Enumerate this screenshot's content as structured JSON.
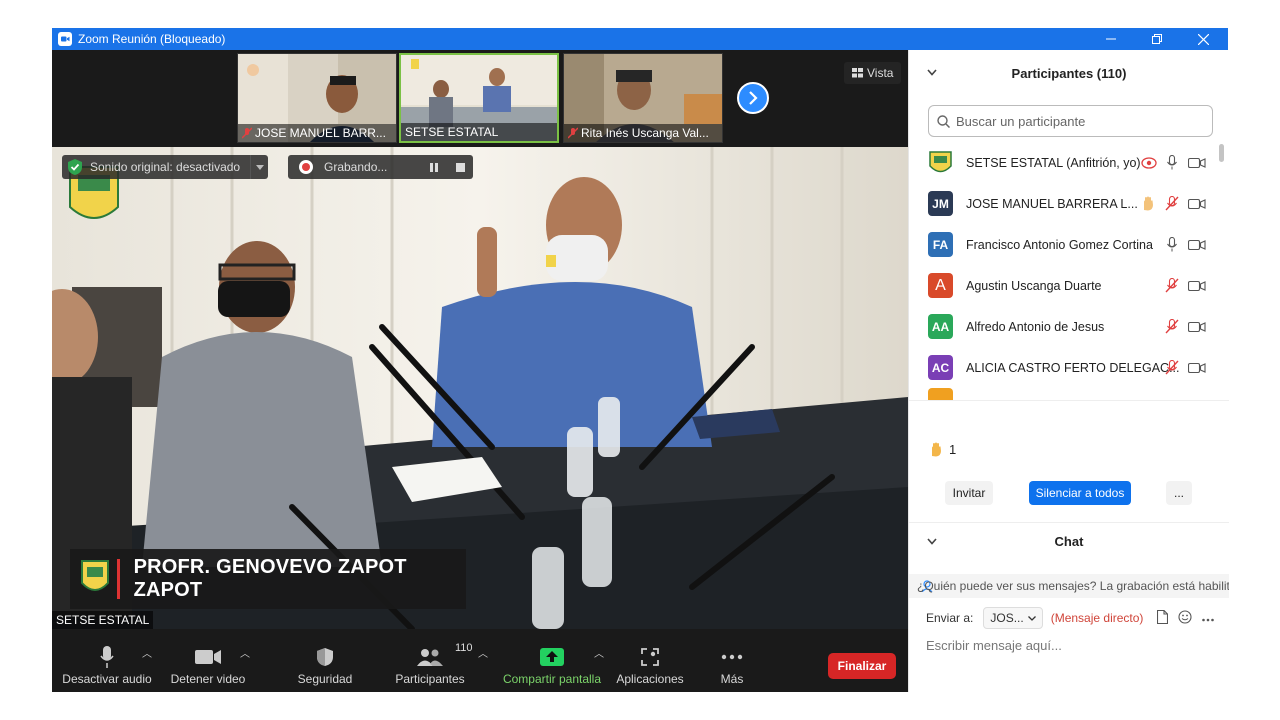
{
  "window": {
    "title": "Zoom Reunión (Bloqueado)"
  },
  "strip": {
    "thumbnails": [
      {
        "label": "JOSE MANUEL BARR..."
      },
      {
        "label": "SETSE ESTATAL"
      },
      {
        "label": "Rita Inés Uscanga Val..."
      }
    ],
    "view_label": "Vista"
  },
  "main_video": {
    "sound_label": "Sonido original: desactivado",
    "recording_label": "Grabando...",
    "speaker_name": "PROFR. GENOVEVO ZAPOT ZAPOT",
    "video_label": "SETSE ESTATAL"
  },
  "toolbar": {
    "mute_label": "Desactivar audio",
    "video_label": "Detener video",
    "security_label": "Seguridad",
    "participants_label": "Participantes",
    "participants_count": "110",
    "share_label": "Compartir pantalla",
    "apps_label": "Aplicaciones",
    "more_label": "Más",
    "end_label": "Finalizar"
  },
  "panel": {
    "title": "Participantes (110)",
    "search_placeholder": "Buscar un participante",
    "participants": [
      {
        "initials": "",
        "name": "SETSE ESTATAL (Anfitrión, yo)",
        "color": "#ffffff",
        "mic": "on",
        "cam": "off",
        "rec": true,
        "hand": false
      },
      {
        "initials": "JM",
        "name": "JOSE MANUEL BARRERA L...",
        "color": "#2b3a55",
        "mic": "muted",
        "cam": "off",
        "rec": false,
        "hand": true
      },
      {
        "initials": "FA",
        "name": "Francisco Antonio Gomez Cortina",
        "color": "#2e6fb5",
        "mic": "on",
        "cam": "off",
        "rec": false,
        "hand": false
      },
      {
        "initials": "A",
        "name": "Agustin Uscanga Duarte",
        "color": "#d94a2a",
        "mic": "muted",
        "cam": "off",
        "rec": false,
        "hand": false
      },
      {
        "initials": "AA",
        "name": "Alfredo Antonio de Jesus",
        "color": "#2aa85a",
        "mic": "muted",
        "cam": "off",
        "rec": false,
        "hand": false
      },
      {
        "initials": "AC",
        "name": "ALICIA CASTRO FERTO DELEGAC...",
        "color": "#7a3fb5",
        "mic": "muted",
        "cam": "off",
        "rec": false,
        "hand": false
      }
    ],
    "raised_hands": "1",
    "invite_label": "Invitar",
    "mute_all_label": "Silenciar a todos",
    "more_label": "...",
    "chat_title": "Chat",
    "chat_note": "¿Quién puede ver sus mensajes? La grabación está habilitada",
    "send_to_label": "Enviar a:",
    "send_to_value": "JOS...",
    "direct_label": "(Mensaje directo)",
    "message_placeholder": "Escribir mensaje aquí..."
  }
}
